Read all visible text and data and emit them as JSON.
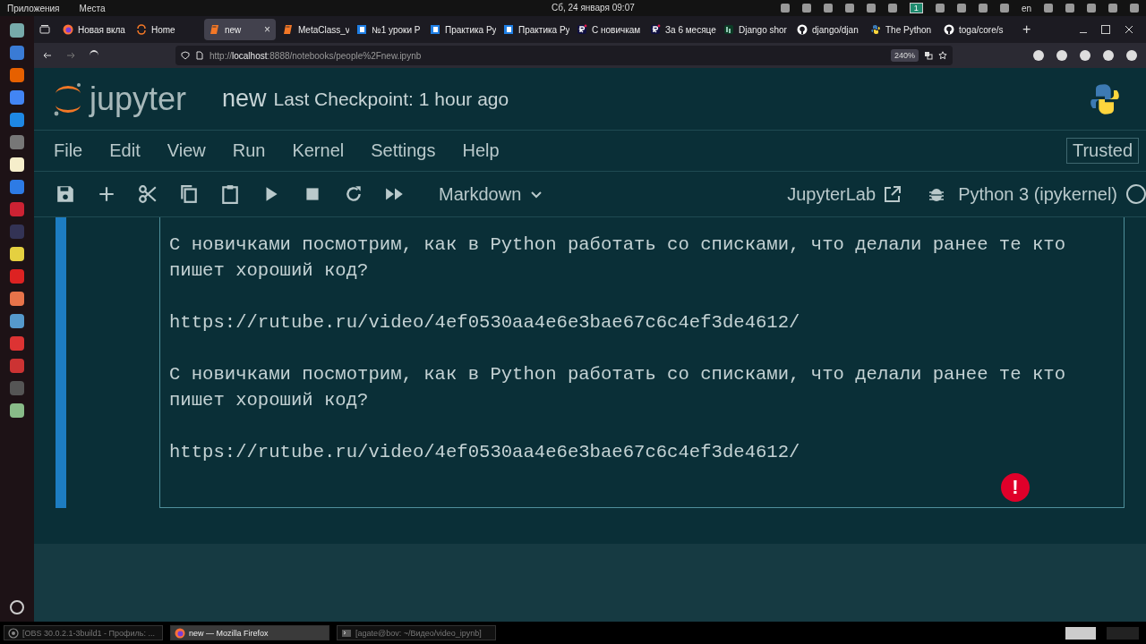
{
  "system_bar": {
    "menus": [
      "Приложения",
      "Места"
    ],
    "clock": "Сб, 24 января 09:07",
    "workspace": "1",
    "language": "en"
  },
  "browser": {
    "tabs": [
      {
        "label": "Новая вкла",
        "kind": "firefox",
        "selected": false
      },
      {
        "label": "Home",
        "kind": "ring",
        "selected": false
      },
      {
        "label": "new",
        "kind": "book",
        "selected": true,
        "close": "×"
      },
      {
        "label": "MetaClass_v",
        "kind": "book",
        "selected": false
      },
      {
        "label": "№1 уроки P",
        "kind": "blue",
        "selected": false
      },
      {
        "label": "Практика Ру",
        "kind": "blue",
        "selected": false
      },
      {
        "label": "Практика Ру",
        "kind": "blue",
        "selected": false
      },
      {
        "label": "С новичкам",
        "kind": "r",
        "selected": false
      },
      {
        "label": "За 6 месяце",
        "kind": "r",
        "selected": false
      },
      {
        "label": "Django shor",
        "kind": "django",
        "selected": false
      },
      {
        "label": "django/djan",
        "kind": "github",
        "selected": false
      },
      {
        "label": "The Python",
        "kind": "python",
        "selected": false
      },
      {
        "label": "toga/core/s",
        "kind": "github",
        "selected": false
      }
    ],
    "new_tab": "+",
    "url_scheme": "http://",
    "url_host": "localhost",
    "url_rest": ":8888/notebooks/people%2Fnew.ipynb",
    "zoom": "240%"
  },
  "jupyter": {
    "logo": "jupyter",
    "notebook_name": "new",
    "checkpoint": "Last Checkpoint: 1 hour ago",
    "menu": [
      "File",
      "Edit",
      "View",
      "Run",
      "Kernel",
      "Settings",
      "Help"
    ],
    "trusted": "Trusted",
    "cell_type": "Markdown",
    "lab_link": "JupyterLab",
    "kernel": "Python 3 (ipykernel)",
    "cell": {
      "paragraphs": [
        "С новичками посмотрим, как в Python работать со списками, что делали ранее те кто пишет хороший код?",
        "https://rutube.ru/video/4ef0530aa4e6e3bae67c6c4ef3de4612/",
        "С новичками посмотрим, как в Python работать со списками, что делали ранее те кто пишет хороший код?",
        "https://rutube.ru/video/4ef0530aa4e6e3bae67c6c4ef3de4612/"
      ]
    },
    "error_badge": "!"
  },
  "taskbar": [
    {
      "label": "[OBS 30.0.2.1-3build1 - Профиль: ...",
      "kind": "obs",
      "selected": false
    },
    {
      "label": "new — Mozilla Firefox",
      "kind": "firefox",
      "selected": true
    },
    {
      "label": "[agate@bov: ~/Видео/video_ipynb]",
      "kind": "terminal",
      "selected": false
    }
  ]
}
